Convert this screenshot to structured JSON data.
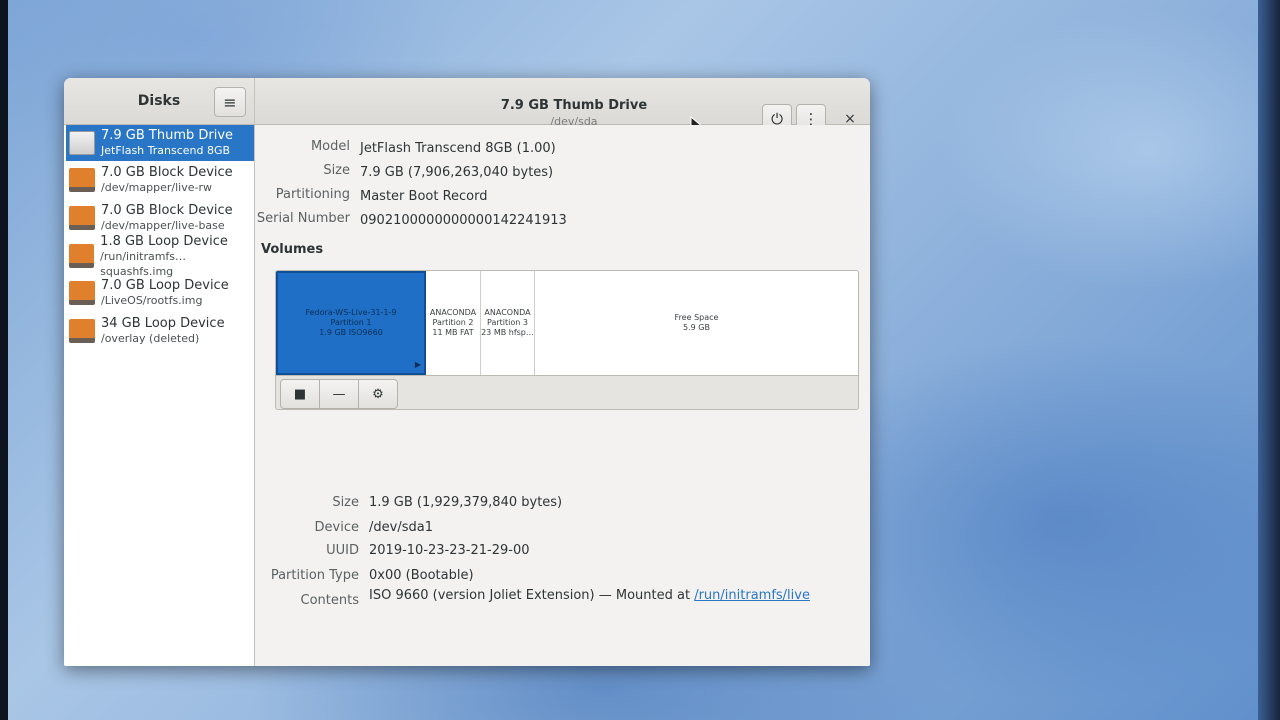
{
  "header": {
    "sidebar_title": "Disks",
    "title": "7.9 GB Thumb Drive",
    "subtitle": "/dev/sda",
    "menu_icon": "≡",
    "power_icon": "⏻",
    "kebab_icon": "⋮",
    "close_icon": "×"
  },
  "devices": [
    {
      "name": "7.9 GB Thumb Drive",
      "sub": "JetFlash Transcend 8GB",
      "icon": "usb-drive-icon",
      "selected": true
    },
    {
      "name": "7.0 GB Block Device",
      "sub": "/dev/mapper/live-rw",
      "icon": "block-device-icon"
    },
    {
      "name": "7.0 GB Block Device",
      "sub": "/dev/mapper/live-base",
      "icon": "block-device-icon"
    },
    {
      "name": "1.8 GB Loop Device",
      "sub": "/run/initramfs…squashfs.img",
      "icon": "loop-device-icon"
    },
    {
      "name": "7.0 GB Loop Device",
      "sub": "/LiveOS/rootfs.img",
      "icon": "loop-device-icon"
    },
    {
      "name": "34 GB Loop Device",
      "sub": "/overlay (deleted)",
      "icon": "loop-device-icon"
    }
  ],
  "drive": {
    "model_label": "Model",
    "model": "JetFlash Transcend 8GB (1.00)",
    "size_label": "Size",
    "size": "7.9 GB (7,906,263,040 bytes)",
    "partitioning_label": "Partitioning",
    "partitioning": "Master Boot Record",
    "serial_label": "Serial Number",
    "serial": "0902100000000000142241913"
  },
  "volumes": {
    "title": "Volumes",
    "partitions": [
      {
        "name": "Fedora-WS-Live-31-1-9",
        "part": "Partition 1",
        "desc": "1.9 GB ISO9660",
        "selected": true
      },
      {
        "name": "ANACONDA",
        "part": "Partition 2",
        "desc": "11 MB FAT"
      },
      {
        "name": "ANACONDA",
        "part": "Partition 3",
        "desc": "23 MB hfsp…"
      },
      {
        "name": "Free Space",
        "desc": "5.9 GB"
      }
    ],
    "tools": {
      "stop": "■",
      "remove": "—",
      "settings": "⚙"
    }
  },
  "partition_details": {
    "size_label": "Size",
    "size": "1.9 GB (1,929,379,840 bytes)",
    "device_label": "Device",
    "device": "/dev/sda1",
    "uuid_label": "UUID",
    "uuid": "2019-10-23-23-21-29-00",
    "type_label": "Partition Type",
    "type": "0x00 (Bootable)",
    "contents_label": "Contents",
    "contents": "ISO 9660 (version Joliet Extension) — Mounted at ",
    "mount_link": "/run/initramfs/live"
  }
}
